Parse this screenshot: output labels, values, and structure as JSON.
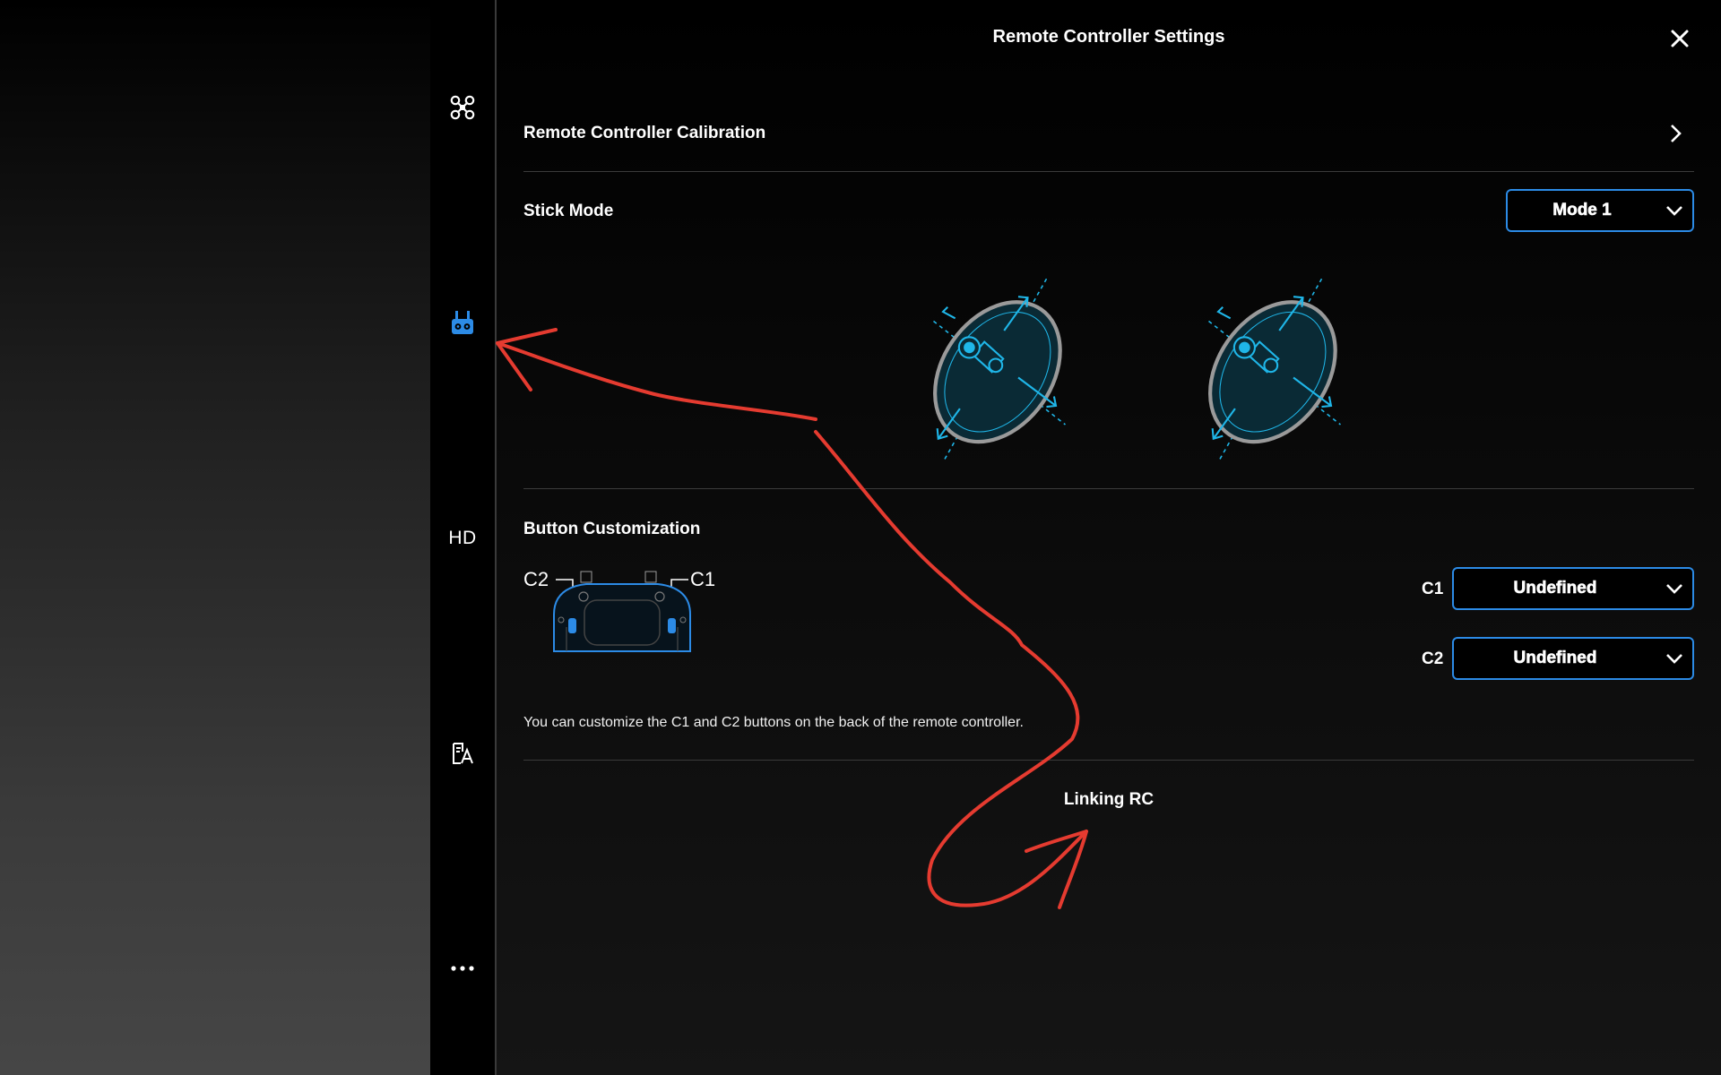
{
  "window": {
    "title": "Remote Controller Settings"
  },
  "nav": {
    "items": [
      {
        "name": "aircraft",
        "icon": "drone-icon"
      },
      {
        "name": "remote-controller",
        "icon": "remote-controller-icon",
        "active": true
      },
      {
        "name": "hd",
        "label": "HD"
      },
      {
        "name": "general",
        "icon": "language-icon"
      },
      {
        "name": "more",
        "icon": "more-dots-icon"
      }
    ]
  },
  "calibration": {
    "label": "Remote Controller Calibration"
  },
  "stick_mode": {
    "label": "Stick Mode",
    "value": "Mode 1"
  },
  "button_customization": {
    "label": "Button Customization",
    "diagram": {
      "c2_label": "C2",
      "c1_label": "C1"
    },
    "c1": {
      "label": "C1",
      "value": "Undefined"
    },
    "c2": {
      "label": "C2",
      "value": "Undefined"
    },
    "hint": "You can customize the C1 and C2 buttons on the back of the remote controller."
  },
  "linking": {
    "label": "Linking RC"
  },
  "colors": {
    "accent": "#2c8be6",
    "annotation": "#e53b30",
    "stick_cyan": "#1fb6e8"
  }
}
